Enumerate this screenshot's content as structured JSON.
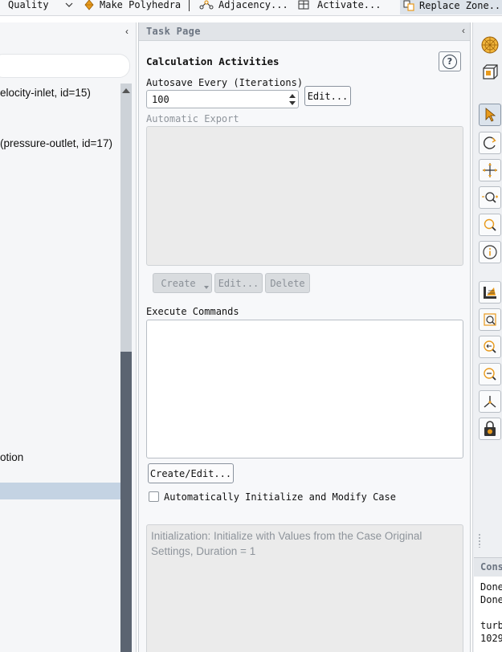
{
  "toolbar": {
    "quality_label": "Quality",
    "polyhedra_label": "Make Polyhedra",
    "adjacency_label": "Adjacency...",
    "activate_label": "Activate...",
    "replace_zone_label": "Replace Zone..."
  },
  "left_pane": {
    "collapse_glyph": "‹",
    "tree_items": [
      "elocity-inlet, id=15)",
      "(pressure-outlet, id=17)",
      "otion"
    ]
  },
  "task_page": {
    "header_title": "Task Page",
    "collapse_glyph": "‹",
    "section_title": "Calculation Activities",
    "help_glyph": "?",
    "autosave_label": "Autosave Every (Iterations)",
    "autosave_value": "100",
    "autosave_edit": "Edit...",
    "auto_export_label": "Automatic Export",
    "create_btn": "Create",
    "edit_btn": "Edit...",
    "delete_btn": "Delete",
    "execute_label": "Execute Commands",
    "create_edit_btn": "Create/Edit...",
    "auto_init_label": "Automatically Initialize and Modify Case",
    "init_text": "Initialization: Initialize with Values from the Case Original Settings, Duration = 1"
  },
  "console": {
    "title": "Console",
    "lines": [
      "Done.",
      "Done.",
      "",
      " turb",
      "1029"
    ]
  },
  "icons": {
    "right_toolbar": [
      "mesh-sphere-icon",
      "view-box-icon",
      "select-pointer-icon",
      "rotate-icon",
      "pan-icon",
      "zoom-in-out-icon",
      "zoom-icon",
      "info-icon",
      "render-icon",
      "zoom-box-icon",
      "zoom-prev-icon",
      "zoom-out-icon",
      "axes-icon",
      "lock-icon"
    ]
  },
  "colors": {
    "accent_orange": "#e89a1c",
    "selection": "#c4d3e3",
    "scroll_thumb": "#5b6471"
  }
}
